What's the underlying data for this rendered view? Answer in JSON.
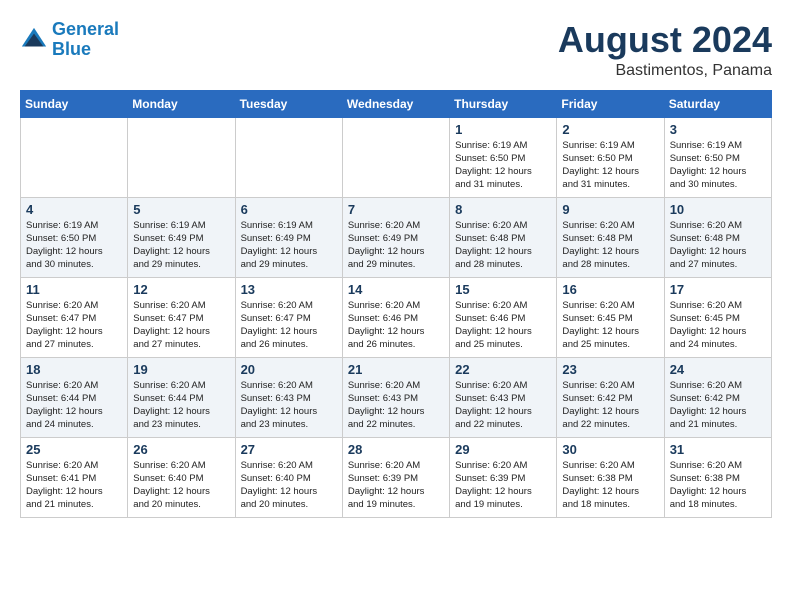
{
  "header": {
    "logo_line1": "General",
    "logo_line2": "Blue",
    "month": "August 2024",
    "location": "Bastimentos, Panama"
  },
  "weekdays": [
    "Sunday",
    "Monday",
    "Tuesday",
    "Wednesday",
    "Thursday",
    "Friday",
    "Saturday"
  ],
  "weeks": [
    [
      {
        "day": "",
        "info": ""
      },
      {
        "day": "",
        "info": ""
      },
      {
        "day": "",
        "info": ""
      },
      {
        "day": "",
        "info": ""
      },
      {
        "day": "1",
        "info": "Sunrise: 6:19 AM\nSunset: 6:50 PM\nDaylight: 12 hours\nand 31 minutes."
      },
      {
        "day": "2",
        "info": "Sunrise: 6:19 AM\nSunset: 6:50 PM\nDaylight: 12 hours\nand 31 minutes."
      },
      {
        "day": "3",
        "info": "Sunrise: 6:19 AM\nSunset: 6:50 PM\nDaylight: 12 hours\nand 30 minutes."
      }
    ],
    [
      {
        "day": "4",
        "info": "Sunrise: 6:19 AM\nSunset: 6:50 PM\nDaylight: 12 hours\nand 30 minutes."
      },
      {
        "day": "5",
        "info": "Sunrise: 6:19 AM\nSunset: 6:49 PM\nDaylight: 12 hours\nand 29 minutes."
      },
      {
        "day": "6",
        "info": "Sunrise: 6:19 AM\nSunset: 6:49 PM\nDaylight: 12 hours\nand 29 minutes."
      },
      {
        "day": "7",
        "info": "Sunrise: 6:20 AM\nSunset: 6:49 PM\nDaylight: 12 hours\nand 29 minutes."
      },
      {
        "day": "8",
        "info": "Sunrise: 6:20 AM\nSunset: 6:48 PM\nDaylight: 12 hours\nand 28 minutes."
      },
      {
        "day": "9",
        "info": "Sunrise: 6:20 AM\nSunset: 6:48 PM\nDaylight: 12 hours\nand 28 minutes."
      },
      {
        "day": "10",
        "info": "Sunrise: 6:20 AM\nSunset: 6:48 PM\nDaylight: 12 hours\nand 27 minutes."
      }
    ],
    [
      {
        "day": "11",
        "info": "Sunrise: 6:20 AM\nSunset: 6:47 PM\nDaylight: 12 hours\nand 27 minutes."
      },
      {
        "day": "12",
        "info": "Sunrise: 6:20 AM\nSunset: 6:47 PM\nDaylight: 12 hours\nand 27 minutes."
      },
      {
        "day": "13",
        "info": "Sunrise: 6:20 AM\nSunset: 6:47 PM\nDaylight: 12 hours\nand 26 minutes."
      },
      {
        "day": "14",
        "info": "Sunrise: 6:20 AM\nSunset: 6:46 PM\nDaylight: 12 hours\nand 26 minutes."
      },
      {
        "day": "15",
        "info": "Sunrise: 6:20 AM\nSunset: 6:46 PM\nDaylight: 12 hours\nand 25 minutes."
      },
      {
        "day": "16",
        "info": "Sunrise: 6:20 AM\nSunset: 6:45 PM\nDaylight: 12 hours\nand 25 minutes."
      },
      {
        "day": "17",
        "info": "Sunrise: 6:20 AM\nSunset: 6:45 PM\nDaylight: 12 hours\nand 24 minutes."
      }
    ],
    [
      {
        "day": "18",
        "info": "Sunrise: 6:20 AM\nSunset: 6:44 PM\nDaylight: 12 hours\nand 24 minutes."
      },
      {
        "day": "19",
        "info": "Sunrise: 6:20 AM\nSunset: 6:44 PM\nDaylight: 12 hours\nand 23 minutes."
      },
      {
        "day": "20",
        "info": "Sunrise: 6:20 AM\nSunset: 6:43 PM\nDaylight: 12 hours\nand 23 minutes."
      },
      {
        "day": "21",
        "info": "Sunrise: 6:20 AM\nSunset: 6:43 PM\nDaylight: 12 hours\nand 22 minutes."
      },
      {
        "day": "22",
        "info": "Sunrise: 6:20 AM\nSunset: 6:43 PM\nDaylight: 12 hours\nand 22 minutes."
      },
      {
        "day": "23",
        "info": "Sunrise: 6:20 AM\nSunset: 6:42 PM\nDaylight: 12 hours\nand 22 minutes."
      },
      {
        "day": "24",
        "info": "Sunrise: 6:20 AM\nSunset: 6:42 PM\nDaylight: 12 hours\nand 21 minutes."
      }
    ],
    [
      {
        "day": "25",
        "info": "Sunrise: 6:20 AM\nSunset: 6:41 PM\nDaylight: 12 hours\nand 21 minutes."
      },
      {
        "day": "26",
        "info": "Sunrise: 6:20 AM\nSunset: 6:40 PM\nDaylight: 12 hours\nand 20 minutes."
      },
      {
        "day": "27",
        "info": "Sunrise: 6:20 AM\nSunset: 6:40 PM\nDaylight: 12 hours\nand 20 minutes."
      },
      {
        "day": "28",
        "info": "Sunrise: 6:20 AM\nSunset: 6:39 PM\nDaylight: 12 hours\nand 19 minutes."
      },
      {
        "day": "29",
        "info": "Sunrise: 6:20 AM\nSunset: 6:39 PM\nDaylight: 12 hours\nand 19 minutes."
      },
      {
        "day": "30",
        "info": "Sunrise: 6:20 AM\nSunset: 6:38 PM\nDaylight: 12 hours\nand 18 minutes."
      },
      {
        "day": "31",
        "info": "Sunrise: 6:20 AM\nSunset: 6:38 PM\nDaylight: 12 hours\nand 18 minutes."
      }
    ]
  ]
}
